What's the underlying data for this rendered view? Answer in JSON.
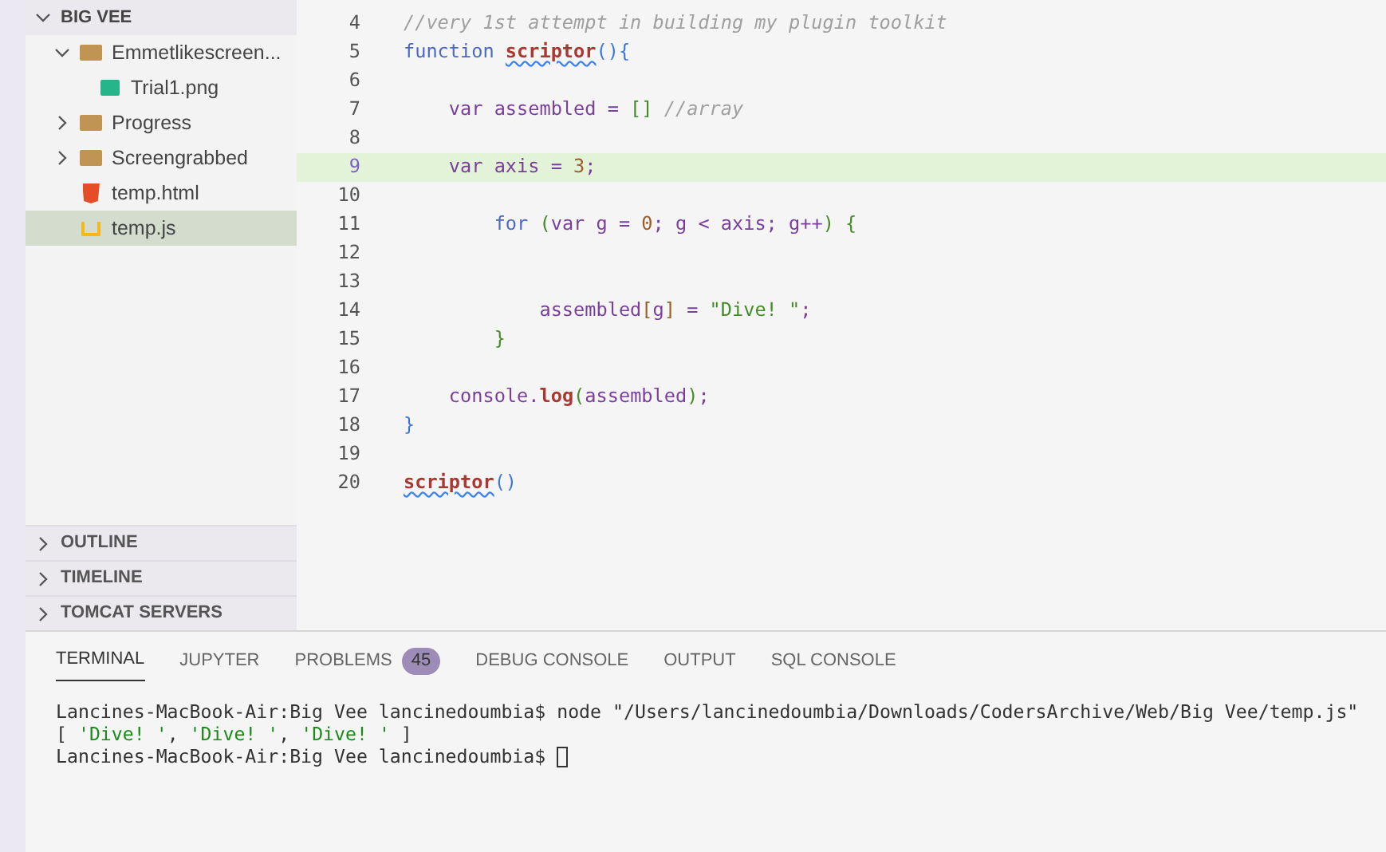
{
  "explorer": {
    "title": "BIG VEE",
    "expanded": true,
    "items": [
      {
        "kind": "folder",
        "label": "Emmetlikescreen...",
        "expanded": true,
        "selected": false,
        "children": [
          {
            "kind": "image",
            "label": "Trial1.png",
            "selected": false
          }
        ]
      },
      {
        "kind": "folder",
        "label": "Progress",
        "expanded": false,
        "selected": false
      },
      {
        "kind": "folder",
        "label": "Screengrabbed",
        "expanded": false,
        "selected": false
      },
      {
        "kind": "html",
        "label": "temp.html",
        "selected": false
      },
      {
        "kind": "js",
        "label": "temp.js",
        "selected": true
      }
    ]
  },
  "sections": [
    {
      "label": "OUTLINE",
      "expanded": false
    },
    {
      "label": "TIMELINE",
      "expanded": false
    },
    {
      "label": "TOMCAT SERVERS",
      "expanded": false
    }
  ],
  "editor": {
    "lines": [
      {
        "number": "4",
        "current": false,
        "tokens": [
          {
            "kind": "comment",
            "text": "//very 1st attempt in building my plugin toolkit"
          }
        ]
      },
      {
        "number": "5",
        "current": false,
        "tokens": [
          {
            "kind": "keyword",
            "text": "function "
          },
          {
            "kind": "func",
            "text": "scriptor",
            "squiggle": true
          },
          {
            "kind": "paren",
            "text": "()"
          },
          {
            "kind": "brace",
            "text": "{"
          }
        ]
      },
      {
        "number": "6",
        "current": false
      },
      {
        "number": "7",
        "current": false,
        "tokens": [
          {
            "kind": "var",
            "text": "    var assembled = "
          },
          {
            "kind": "green",
            "text": "[]"
          },
          {
            "kind": "comment",
            "text": " //array"
          }
        ]
      },
      {
        "number": "8",
        "current": false
      },
      {
        "number": "9",
        "current": true,
        "tokens": [
          {
            "kind": "var",
            "text": "    var axis = "
          },
          {
            "kind": "number",
            "text": "3"
          },
          {
            "kind": "var",
            "text": ";"
          }
        ]
      },
      {
        "number": "10",
        "current": false
      },
      {
        "number": "11",
        "current": false,
        "tokens": [
          {
            "kind": "keyword",
            "text": "        for "
          },
          {
            "kind": "green",
            "text": "("
          },
          {
            "kind": "var",
            "text": "var g = "
          },
          {
            "kind": "number",
            "text": "0"
          },
          {
            "kind": "var",
            "text": "; g < axis; g++"
          },
          {
            "kind": "green",
            "text": ") {"
          }
        ]
      },
      {
        "number": "12",
        "current": false
      },
      {
        "number": "13",
        "current": false
      },
      {
        "number": "14",
        "current": false,
        "tokens": [
          {
            "kind": "var",
            "text": "            assembled"
          },
          {
            "kind": "number",
            "text": "["
          },
          {
            "kind": "var",
            "text": "g"
          },
          {
            "kind": "number",
            "text": "]"
          },
          {
            "kind": "var",
            "text": " = "
          },
          {
            "kind": "string",
            "text": "\"Dive! \""
          },
          {
            "kind": "var",
            "text": ";"
          }
        ]
      },
      {
        "number": "15",
        "current": false,
        "tokens": [
          {
            "kind": "green",
            "text": "        }"
          }
        ]
      },
      {
        "number": "16",
        "current": false
      },
      {
        "number": "17",
        "current": false,
        "tokens": [
          {
            "kind": "var",
            "text": "    console."
          },
          {
            "kind": "func",
            "text": "log"
          },
          {
            "kind": "green",
            "text": "("
          },
          {
            "kind": "var",
            "text": "assembled"
          },
          {
            "kind": "green",
            "text": ")"
          },
          {
            "kind": "var",
            "text": ";"
          }
        ]
      },
      {
        "number": "18",
        "current": false,
        "tokens": [
          {
            "kind": "brace",
            "text": "}"
          }
        ]
      },
      {
        "number": "19",
        "current": false
      },
      {
        "number": "20",
        "current": false,
        "tokens": [
          {
            "kind": "func",
            "text": "scriptor",
            "squiggle": true
          },
          {
            "kind": "paren",
            "text": "()"
          }
        ]
      }
    ]
  },
  "panel": {
    "tabs": [
      {
        "label": "TERMINAL",
        "selected": true
      },
      {
        "label": "JUPYTER",
        "selected": false
      },
      {
        "label": "PROBLEMS",
        "selected": false,
        "badge": "45"
      },
      {
        "label": "DEBUG CONSOLE",
        "selected": false
      },
      {
        "label": "OUTPUT",
        "selected": false
      },
      {
        "label": "SQL CONSOLE",
        "selected": false
      }
    ],
    "terminal": [
      {
        "kind": "command",
        "prompt": "Lancines-MacBook-Air:Big Vee lancinedoumbia$",
        "text": "node \"/Users/lancinedoumbia/Downloads/CodersArchive/Web/Big Vee/temp.js\""
      },
      {
        "kind": "output",
        "parts": [
          {
            "kind": "plain",
            "text": "[ "
          },
          {
            "kind": "string",
            "text": "'Dive! '"
          },
          {
            "kind": "plain",
            "text": ", "
          },
          {
            "kind": "string",
            "text": "'Dive! '"
          },
          {
            "kind": "plain",
            "text": ", "
          },
          {
            "kind": "string",
            "text": "'Dive! '"
          },
          {
            "kind": "plain",
            "text": " ]"
          }
        ]
      },
      {
        "kind": "prompt",
        "prompt": "Lancines-MacBook-Air:Big Vee lancinedoumbia$",
        "cursor": true
      }
    ]
  }
}
